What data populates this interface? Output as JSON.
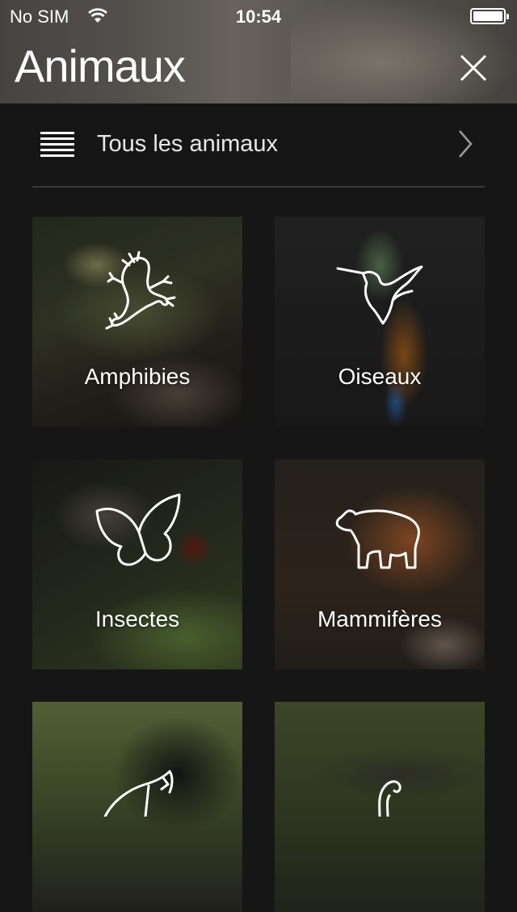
{
  "status_bar": {
    "carrier": "No SIM",
    "time": "10:54",
    "battery_level": 1.0
  },
  "header": {
    "title": "Animaux",
    "close_icon": "close-icon"
  },
  "all_animals": {
    "label": "Tous les animaux",
    "icon": "list-icon",
    "chevron": "chevron-right-icon"
  },
  "categories": [
    {
      "label": "Amphibies",
      "icon": "frog-icon"
    },
    {
      "label": "Oiseaux",
      "icon": "bird-icon"
    },
    {
      "label": "Insectes",
      "icon": "butterfly-icon"
    },
    {
      "label": "Mammifères",
      "icon": "bear-icon"
    },
    {
      "label": "",
      "icon": "gorilla-icon"
    },
    {
      "label": "",
      "icon": "snake-icon"
    }
  ]
}
